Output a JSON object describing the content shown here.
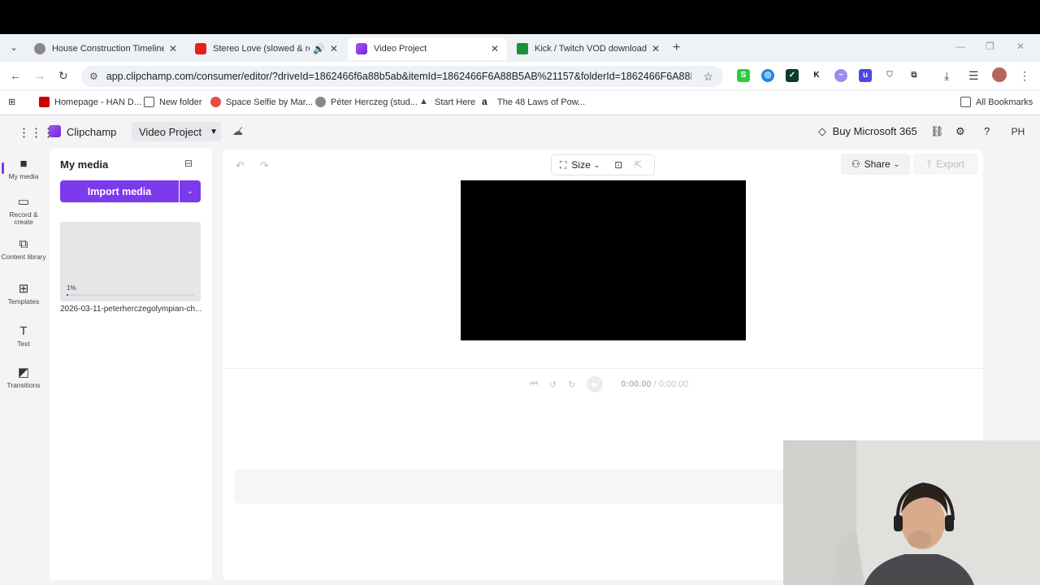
{
  "browser": {
    "tabs": [
      {
        "title": "House Construction Timeline",
        "favicon_color": "#666666",
        "active": false
      },
      {
        "title": "Stereo Love (slowed & reve",
        "favicon_color": "#e62117",
        "active": false,
        "audio": "🔊"
      },
      {
        "title": "Video Project",
        "favicon_color": "#8b5cf6",
        "active": true
      },
      {
        "title": "Kick / Twitch VOD downloader",
        "favicon_color": "#1a8f3c",
        "active": false
      }
    ],
    "tab_close": "✕",
    "new_tab": "+",
    "window_controls": {
      "minimize": "—",
      "maximize": "❐",
      "close": "✕"
    },
    "nav": {
      "back": "←",
      "forward": "→",
      "reload": "↻"
    },
    "url": "app.clipchamp.com/consumer/editor/?driveId=1862466f6a88b5ab&itemId=1862466F6A88B5AB%21157&folderId=1862466F6A88B5AB%2...",
    "star": "☆",
    "toolbar": {
      "download": "⤓",
      "menu": "⋮"
    },
    "bookmarks": [
      {
        "label": "Homepage - HAN D...",
        "color": "#cc0000"
      },
      {
        "label": "New folder",
        "color": "#555555"
      },
      {
        "label": "Space Selfie by Mar...",
        "color": "#e74c3c"
      },
      {
        "label": "Péter Herczeg (stud...",
        "color": "#666666"
      },
      {
        "label": "Start Here",
        "color": "#444444"
      },
      {
        "label": "The 48 Laws of Pow...",
        "color": "#222222"
      }
    ],
    "all_bookmarks": "All Bookmarks"
  },
  "app": {
    "brand": "Clipchamp",
    "project_name": "Video Project",
    "buy": "Buy Microsoft 365",
    "avatar_initials": "PH",
    "nav": [
      {
        "label": "My media",
        "icon": "■"
      },
      {
        "label": "Record & create",
        "icon": "▭"
      },
      {
        "label": "Content library",
        "icon": "⧉"
      },
      {
        "label": "Templates",
        "icon": "⊞"
      },
      {
        "label": "Text",
        "icon": "T"
      },
      {
        "label": "Transitions",
        "icon": "◩"
      }
    ],
    "media_panel": {
      "title": "My media",
      "import_label": "Import media",
      "progress_text": "1%",
      "progress": 0.01,
      "file_name": "2026-03-11-peterherczegolympian-ch..."
    },
    "editor": {
      "size_label": "Size",
      "share_label": "Share",
      "export_label": "Export",
      "time_current": "0:00.00",
      "time_separator": "/",
      "time_total": "0:00.00"
    }
  }
}
